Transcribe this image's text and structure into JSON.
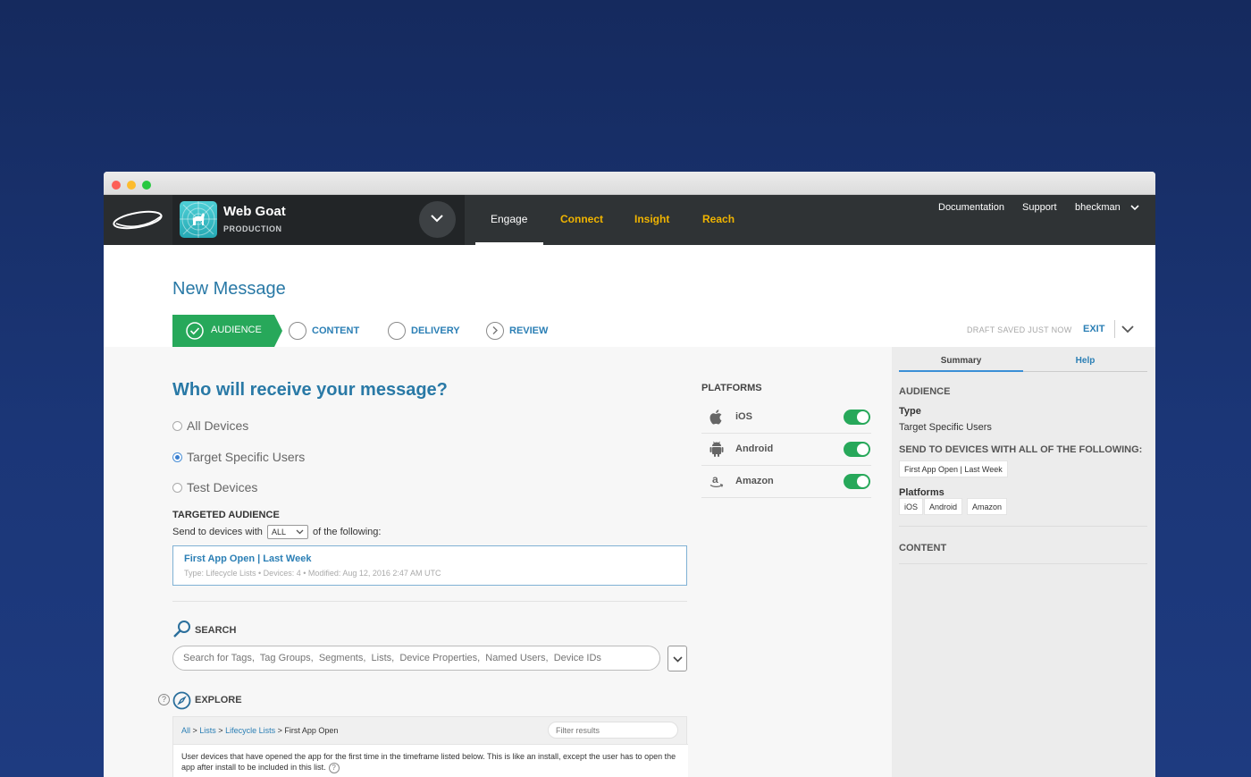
{
  "window": {
    "controls": [
      "close",
      "minimize",
      "zoom"
    ]
  },
  "app": {
    "name": "Web Goat",
    "environment": "PRODUCTION"
  },
  "nav": {
    "tabs": [
      {
        "label": "Engage",
        "active": true
      },
      {
        "label": "Connect",
        "active": false
      },
      {
        "label": "Insight",
        "active": false
      },
      {
        "label": "Reach",
        "active": false
      }
    ],
    "links": {
      "documentation": "Documentation",
      "support": "Support",
      "user": "bheckman"
    }
  },
  "page": {
    "title": "New Message"
  },
  "steps": [
    {
      "label": "AUDIENCE",
      "state": "complete"
    },
    {
      "label": "CONTENT",
      "state": "pending"
    },
    {
      "label": "DELIVERY",
      "state": "pending"
    },
    {
      "label": "REVIEW",
      "state": "next"
    }
  ],
  "draft": {
    "status": "DRAFT SAVED JUST NOW",
    "exit_label": "EXIT"
  },
  "audience": {
    "question": "Who will receive your message?",
    "options": [
      {
        "label": "All Devices",
        "selected": false
      },
      {
        "label": "Target Specific Users",
        "selected": true
      },
      {
        "label": "Test Devices",
        "selected": false
      }
    ],
    "targeted_label": "TARGETED AUDIENCE",
    "send_prefix": "Send to devices with",
    "send_mode": "ALL",
    "send_suffix": "of the following:",
    "selected_item": {
      "name": "First App Open | Last Week",
      "meta": "Type: Lifecycle Lists • Devices: 4 • Modified: Aug 12, 2016 2:47 AM UTC"
    }
  },
  "search": {
    "label": "SEARCH",
    "placeholder": "Search for Tags,  Tag Groups,  Segments,  Lists,  Device Properties,  Named Users,  Device IDs"
  },
  "explore": {
    "label": "EXPLORE",
    "help": "?",
    "breadcrumb": {
      "all": "All",
      "lists": "Lists",
      "lifecycle": "Lifecycle Lists",
      "current": "First App Open",
      "sep": " > "
    },
    "filter_placeholder": "Filter results",
    "description": "User devices that have opened the app for the first time in the timeframe listed below. This is like an install, except the user has to open the app after install to be included in this list."
  },
  "platforms": {
    "title": "PLATFORMS",
    "items": [
      {
        "name": "iOS",
        "enabled": true,
        "icon": "apple-icon"
      },
      {
        "name": "Android",
        "enabled": true,
        "icon": "android-icon"
      },
      {
        "name": "Amazon",
        "enabled": true,
        "icon": "amazon-icon"
      }
    ]
  },
  "summary": {
    "tabs": [
      "Summary",
      "Help"
    ],
    "audience_heading": "AUDIENCE",
    "type_label": "Type",
    "type_value": "Target Specific Users",
    "send_heading": "SEND TO DEVICES WITH ALL OF THE FOLLOWING:",
    "send_items": [
      "First App Open | Last Week"
    ],
    "platforms_label": "Platforms",
    "platform_chips": [
      "iOS",
      "Android",
      "Amazon"
    ],
    "content_heading": "CONTENT"
  },
  "colors": {
    "accent": "#2b7fb5",
    "success": "#27a85a",
    "nav_highlight": "#f0b400",
    "appbar": "#2f3335"
  }
}
